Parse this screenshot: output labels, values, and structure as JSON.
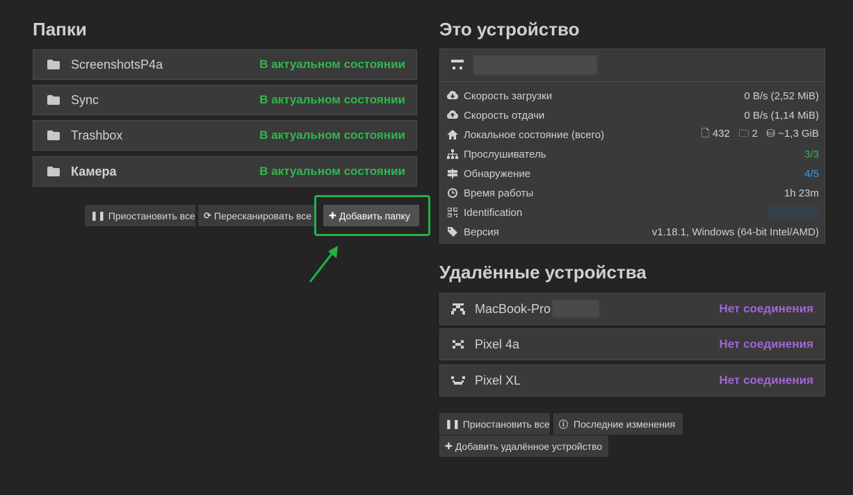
{
  "folders_section": {
    "title": "Папки",
    "folders": [
      {
        "name": "ScreenshotsP4a",
        "status": "В актуальном состоянии"
      },
      {
        "name": "Sync",
        "status": "В актуальном состоянии"
      },
      {
        "name": "Trashbox",
        "status": "В актуальном состоянии"
      },
      {
        "name": "Камера",
        "status": "В актуальном состоянии"
      }
    ],
    "buttons": {
      "pause_all": "Приостановить все",
      "rescan_all": "Пересканировать все",
      "add_folder": "Добавить папку"
    }
  },
  "this_device": {
    "title": "Это устройство",
    "rows": [
      {
        "label": "Скорость загрузки",
        "value": "0 B/s (2,52 MiB)",
        "icon": "cloud-download-icon"
      },
      {
        "label": "Скорость отдачи",
        "value": "0 B/s (1,14 MiB)",
        "icon": "cloud-upload-icon"
      },
      {
        "label": "Локальное состояние (всего)",
        "icon": "home-icon",
        "files": "432",
        "dirs": "2",
        "size": "~1,3 GiB"
      },
      {
        "label": "Прослушиватель",
        "value": "3/3",
        "icon": "sitemap-icon"
      },
      {
        "label": "Обнаружение",
        "value": "4/5",
        "icon": "signpost-icon"
      },
      {
        "label": "Время работы",
        "value": "1h 23m",
        "icon": "clock-icon"
      },
      {
        "label": "Identification",
        "icon": "qrcode-icon"
      },
      {
        "label": "Версия",
        "value": "v1.18.1, Windows (64-bit Intel/AMD)",
        "icon": "tag-icon"
      }
    ],
    "colors": {
      "ok": "#2db84e",
      "info": "#3d9be9"
    }
  },
  "remote_devices": {
    "title": "Удалённые устройства",
    "devices": [
      {
        "name": "MacBook-Pro",
        "status": "Нет соединения"
      },
      {
        "name": "Pixel 4a",
        "status": "Нет соединения"
      },
      {
        "name": "Pixel XL",
        "status": "Нет соединения"
      }
    ],
    "buttons": {
      "pause_all": "Приостановить все",
      "recent_changes": "Последние изменения",
      "add_remote": "Добавить удалённое устройство"
    },
    "status_color": "#a067d4"
  }
}
